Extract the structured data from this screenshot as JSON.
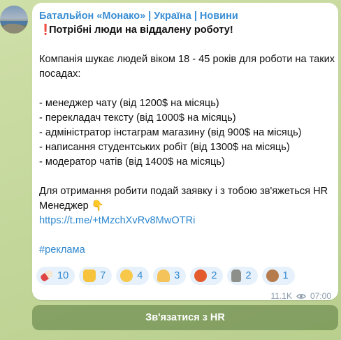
{
  "channel": {
    "name": "Батальйон «Монако» | Україна | Новини"
  },
  "post": {
    "headline": "Потрібні люди на віддалену роботу!",
    "intro_line1": "Компанія шукає людей віком 18 - 45 років для роботи на таких",
    "intro_line2": "посадах:",
    "positions": [
      "- менеджер чату (від 1200$ на місяць)",
      "- перекладач тексту (від 1000$ на місяць)",
      "- адміністратор інстаграм магазину (від 900$ на місяць)",
      "- написання студентських робіт (від 1300$ на місяць)",
      "- модератор чатів (від 1400$ на місяць)"
    ],
    "apply_line1": "Для отримання робити подай заявку і з тобою зв'яжеться HR",
    "apply_line2": "Менеджер 👇",
    "link": "https://t.me/+tMzchXvRv8MwOTRi",
    "hashtag": "#реклама"
  },
  "reactions": [
    {
      "icon": "pill-icon",
      "count": "10"
    },
    {
      "icon": "thumbs-up-icon",
      "count": "7"
    },
    {
      "icon": "confused-face-icon",
      "count": "4"
    },
    {
      "icon": "praying-hands-icon",
      "count": "3"
    },
    {
      "icon": "angry-face-icon",
      "count": "2"
    },
    {
      "icon": "moai-icon",
      "count": "2"
    },
    {
      "icon": "see-no-evil-monkey-icon",
      "count": "1"
    }
  ],
  "meta": {
    "views": "11.1K",
    "time": "07:00"
  },
  "cta_button": {
    "label": "Зв'язатися з HR"
  },
  "colors": {
    "accent": "#3a8ed3",
    "link": "#2f88d0",
    "reaction_bg": "#e7f1fb",
    "cta_bg": "#7a9460"
  }
}
